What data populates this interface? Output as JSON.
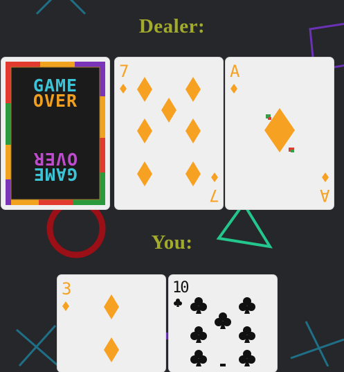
{
  "table": {
    "dealer_label": "Dealer:",
    "player_label": "You:"
  },
  "dealer_hand": [
    {
      "face_down": true,
      "back_text_top": [
        "GAME",
        "OVER"
      ],
      "back_text_bottom": [
        "OVER",
        "GAME"
      ]
    },
    {
      "rank": "7",
      "suit": "diamonds"
    },
    {
      "rank": "A",
      "suit": "diamonds"
    }
  ],
  "player_hand": [
    {
      "rank": "3",
      "suit": "diamonds"
    },
    {
      "rank": "10",
      "suit": "clubs"
    }
  ],
  "colors": {
    "background": "#25272a",
    "heading": "#a3ab2c",
    "diamond": "#f7a122",
    "club": "#111111",
    "card_face": "#efefef"
  }
}
